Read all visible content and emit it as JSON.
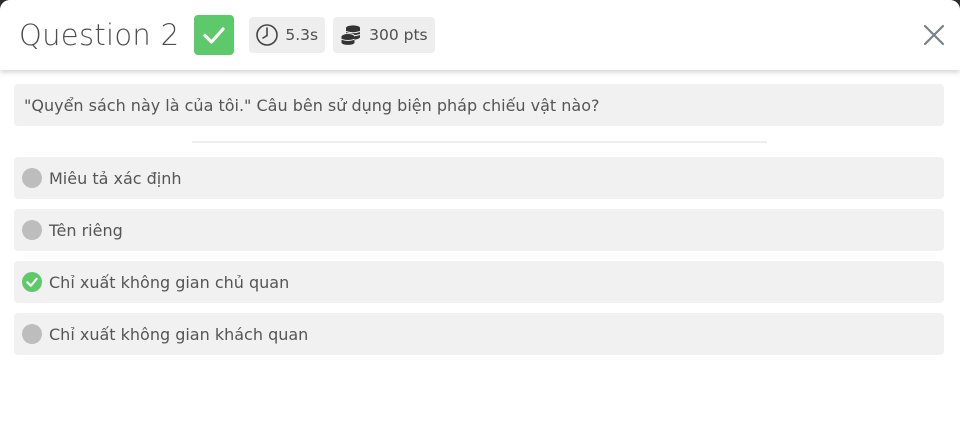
{
  "header": {
    "title": "Question 2",
    "time": "5.3s",
    "points": "300 pts"
  },
  "question": {
    "text": "\"Quyển sách này là của tôi.\" Câu bên sử dụng biện pháp chiếu vật nào?"
  },
  "options": [
    {
      "label": "Miêu tả xác định",
      "status": "unselected"
    },
    {
      "label": "Tên riêng",
      "status": "unselected"
    },
    {
      "label": "Chỉ xuất không gian chủ quan",
      "status": "correct"
    },
    {
      "label": "Chỉ xuất không gian khách quan",
      "status": "unselected"
    }
  ],
  "colors": {
    "correct_green": "#5ec96a",
    "neutral_radio": "#bdbdbd",
    "option_bg": "#f1f1f1",
    "text": "#555555"
  },
  "icons": {
    "result": "checkmark-icon",
    "time": "clock-icon",
    "points": "coins-icon",
    "close": "close-icon"
  }
}
